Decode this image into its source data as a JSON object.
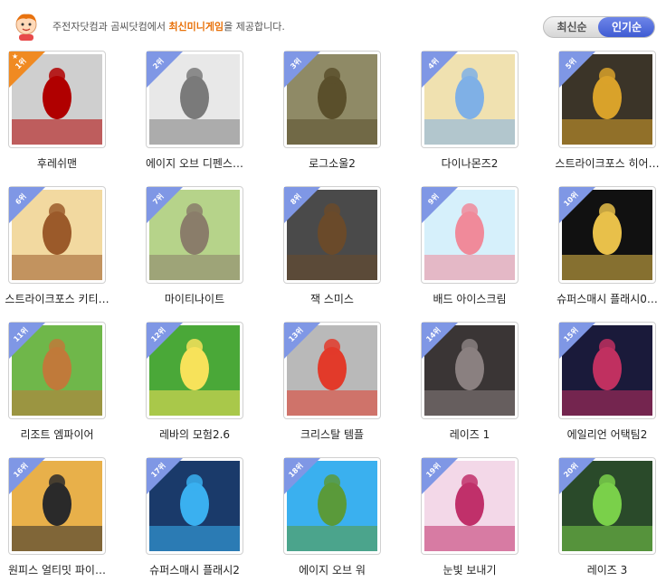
{
  "header": {
    "notice_prefix": "주전자닷컴과 곰씨닷컴에서",
    "notice_highlight": "최신미니게임",
    "notice_suffix": "을 제공합니다.",
    "sort_latest": "최신순",
    "sort_popular": "인기순"
  },
  "games": [
    {
      "rank": "1위",
      "title": "후레쉬맨",
      "c1": "#cfcfcf",
      "c2": "#b00000"
    },
    {
      "rank": "2위",
      "title": "에이지 오브 디펜스…",
      "c1": "#e8e8e8",
      "c2": "#7a7a7a"
    },
    {
      "rank": "3위",
      "title": "로그소울2",
      "c1": "#8f8a66",
      "c2": "#5a4f2b"
    },
    {
      "rank": "4위",
      "title": "다이나몬즈2",
      "c1": "#f0e1b0",
      "c2": "#7fb0e6"
    },
    {
      "rank": "5위",
      "title": "스트라이크포스 히어…",
      "c1": "#3b3428",
      "c2": "#d9a22a"
    },
    {
      "rank": "6위",
      "title": "스트라이크포스 키티…",
      "c1": "#f2d9a0",
      "c2": "#9b5a2a"
    },
    {
      "rank": "7위",
      "title": "마이티나이트",
      "c1": "#b6d38a",
      "c2": "#8a7d6a"
    },
    {
      "rank": "8위",
      "title": "잭 스미스",
      "c1": "#4a4a4a",
      "c2": "#6a4a2a"
    },
    {
      "rank": "9위",
      "title": "배드 아이스크림",
      "c1": "#d6f0fb",
      "c2": "#f08a9a"
    },
    {
      "rank": "10위",
      "title": "슈퍼스매시 플래시0…",
      "c1": "#111111",
      "c2": "#e8c04a"
    },
    {
      "rank": "11위",
      "title": "리조트 엠파이어",
      "c1": "#6fb74a",
      "c2": "#c07a3a"
    },
    {
      "rank": "12위",
      "title": "레바의 모험2.6",
      "c1": "#4aa838",
      "c2": "#f7e25a"
    },
    {
      "rank": "13위",
      "title": "크리스탈 템플",
      "c1": "#b9b9b9",
      "c2": "#e23a2a"
    },
    {
      "rank": "14위",
      "title": "레이즈 1",
      "c1": "#3a3535",
      "c2": "#8a8080"
    },
    {
      "rank": "15위",
      "title": "에일리언 어택팀2",
      "c1": "#1a1a3a",
      "c2": "#c03060"
    },
    {
      "rank": "16위",
      "title": "원피스 얼티밋 파이…",
      "c1": "#e8b04a",
      "c2": "#2a2a2a"
    },
    {
      "rank": "17위",
      "title": "슈퍼스매시 플래시2",
      "c1": "#1a3a6a",
      "c2": "#3ab0f0"
    },
    {
      "rank": "18위",
      "title": "에이지 오브 워",
      "c1": "#3ab0ef",
      "c2": "#5a9a3a"
    },
    {
      "rank": "19위",
      "title": "눈빛 보내기",
      "c1": "#f3d8e8",
      "c2": "#c0306a"
    },
    {
      "rank": "20위",
      "title": "레이즈 3",
      "c1": "#2a4a2a",
      "c2": "#7ad04a"
    }
  ]
}
